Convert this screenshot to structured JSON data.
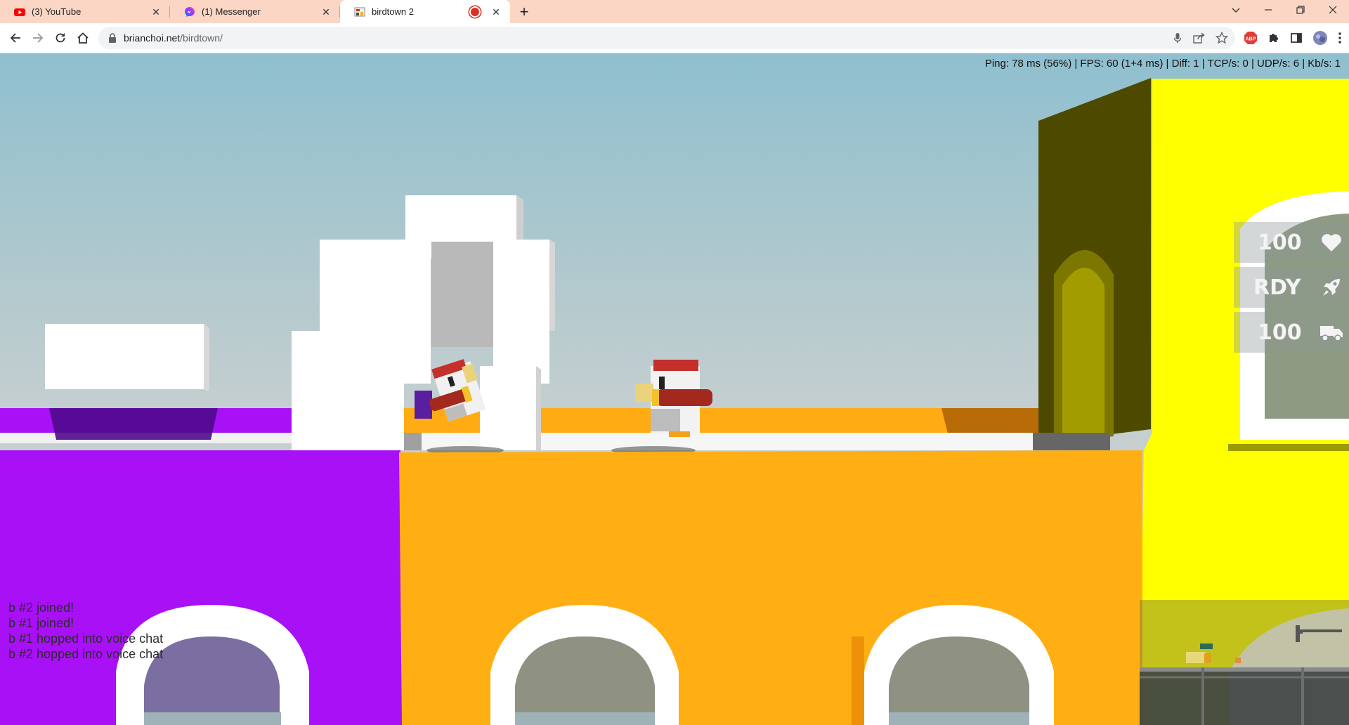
{
  "browser": {
    "tabs": [
      {
        "title": "(3) YouTube",
        "icon": "youtube-icon",
        "active": false
      },
      {
        "title": "(1) Messenger",
        "icon": "messenger-icon",
        "active": false
      },
      {
        "title": "birdtown 2",
        "icon": "birdtown-icon",
        "active": true,
        "recording": true
      }
    ],
    "url_host": "brianchoi.net",
    "url_path": "/birdtown/",
    "extensions": [
      "adblock-icon",
      "puzzle-icon",
      "sidepanel-icon",
      "profile-avatar",
      "menu-icon"
    ]
  },
  "game": {
    "stats_text": "Ping: 78 ms (56%) | FPS: 60 (1+4 ms) | Diff: 1 | TCP/s: 0 | UDP/s: 6 | Kb/s: 1",
    "hud": [
      {
        "value": "100",
        "icon": "heart-icon"
      },
      {
        "value": "RDY",
        "icon": "rocket-icon"
      },
      {
        "value": "100",
        "icon": "truck-icon"
      }
    ],
    "chat": [
      "b #2 joined!",
      "b #1 joined!",
      "b #1 hopped into voice chat",
      "b #2 hopped into voice chat"
    ],
    "colors": {
      "purple": "#a810f5",
      "orange": "#ffad14",
      "yellow": "#ffff00",
      "olive": "#4d4a00"
    }
  }
}
